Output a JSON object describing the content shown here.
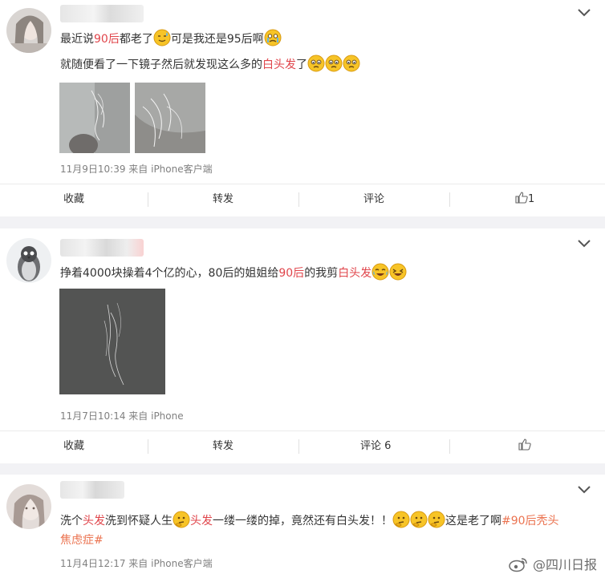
{
  "posts": [
    {
      "line1": {
        "a": "最近说",
        "b": "90后",
        "c": "都老了",
        "d": "可是我还是95后啊"
      },
      "line2": {
        "a": "就随便看了一下镜子然后就发现这么多的",
        "b": "白头发",
        "c": "了"
      },
      "meta": "11月9日10:39 来自 iPhone客户端",
      "actions": {
        "fav": "收藏",
        "repost": "转发",
        "comment": "评论",
        "like": "1"
      }
    },
    {
      "line1": {
        "a": "挣着4000块操着4个亿的心，80后的姐姐给",
        "b": "90后",
        "c": "的我剪",
        "d": "白头发"
      },
      "meta": "11月7日10:14 来自 iPhone",
      "actions": {
        "fav": "收藏",
        "repost": "转发",
        "comment": "评论 6",
        "like": ""
      }
    },
    {
      "line1": {
        "a": "洗个",
        "b": "头发",
        "c": "洗到怀疑人生",
        "d": "头发",
        "e": "一缕一缕的掉，竟然还有白头发！！",
        "f": "这是老了啊",
        "g": "#90后",
        "h": "秃头"
      },
      "line2": {
        "a": "焦虑症#"
      },
      "meta": "11月4日12:17 来自 iPhone客户端"
    }
  ],
  "watermark": "@四川日报",
  "icons": {
    "menu": "chevron-down-icon",
    "like": "thumb-up-icon",
    "weibo": "weibo-logo-icon"
  },
  "colors": {
    "highlight": "#e0454b",
    "topic": "#eb7350",
    "meta": "#808080"
  }
}
